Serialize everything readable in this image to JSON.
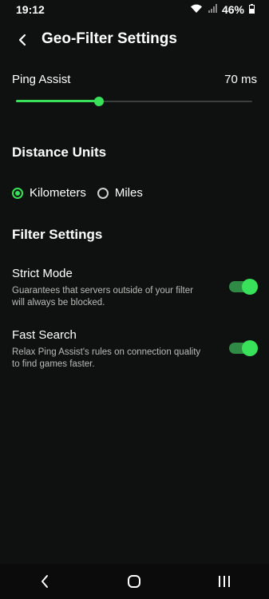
{
  "status_bar": {
    "time": "19:12",
    "battery": "46%"
  },
  "app_bar": {
    "title": "Geo-Filter Settings"
  },
  "ping_assist": {
    "label": "Ping Assist",
    "value_text": "70 ms",
    "slider_fraction": 0.35
  },
  "distance_units": {
    "heading": "Distance Units",
    "options": [
      {
        "label": "Kilometers",
        "selected": true
      },
      {
        "label": "Miles",
        "selected": false
      }
    ]
  },
  "filter_settings": {
    "heading": "Filter Settings",
    "items": [
      {
        "title": "Strict Mode",
        "description": "Guarantees that servers outside of your filter will always be blocked.",
        "enabled": true
      },
      {
        "title": "Fast Search",
        "description": "Relax Ping Assist's rules on connection quality to find games faster.",
        "enabled": true
      }
    ]
  },
  "colors": {
    "accent": "#39e05a",
    "background": "#0f1110"
  },
  "nav_icons": [
    "back-icon",
    "home-icon",
    "recents-icon"
  ]
}
